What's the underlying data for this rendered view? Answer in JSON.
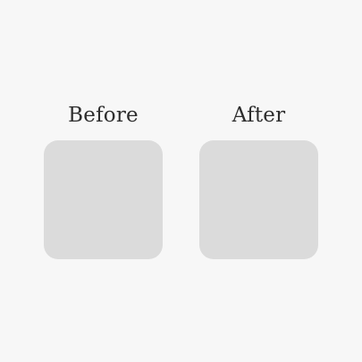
{
  "comparison": {
    "before": {
      "label": "Before"
    },
    "after": {
      "label": "After"
    }
  },
  "colors": {
    "background": "#f7f7f7",
    "tile": "#dbdbdb",
    "text": "#2e2e2e"
  }
}
